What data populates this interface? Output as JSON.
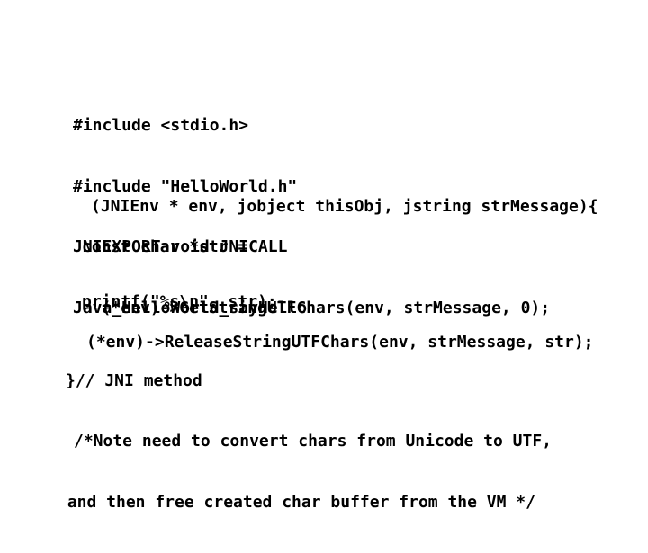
{
  "document": {
    "kind": "code-listing",
    "language": "C",
    "background_color": "#ffffff",
    "text_color": "#000000"
  },
  "code": {
    "includes": [
      "#include <stdio.h>",
      "#include \"HelloWorld.h\"",
      "JNIEXPORT void JNICALL",
      "Java_HelloWorld_sayHello"
    ],
    "signature": "(JNIEnv * env, jobject thisObj, jstring strMessage){",
    "get_string_decl": "const char *str =",
    "get_string_call": "(*env)->GetStringUTFChars(env, strMessage, 0);",
    "printf_call": "printf(\"%s\\n\", str);",
    "release_call": "(*env)->ReleaseStringUTFChars(env, strMessage, str);",
    "close_brace": "}// JNI method",
    "note_line_1": "/*Note need to convert chars from Unicode to UTF,",
    "note_line_2": "and then free created char buffer from the VM */"
  }
}
